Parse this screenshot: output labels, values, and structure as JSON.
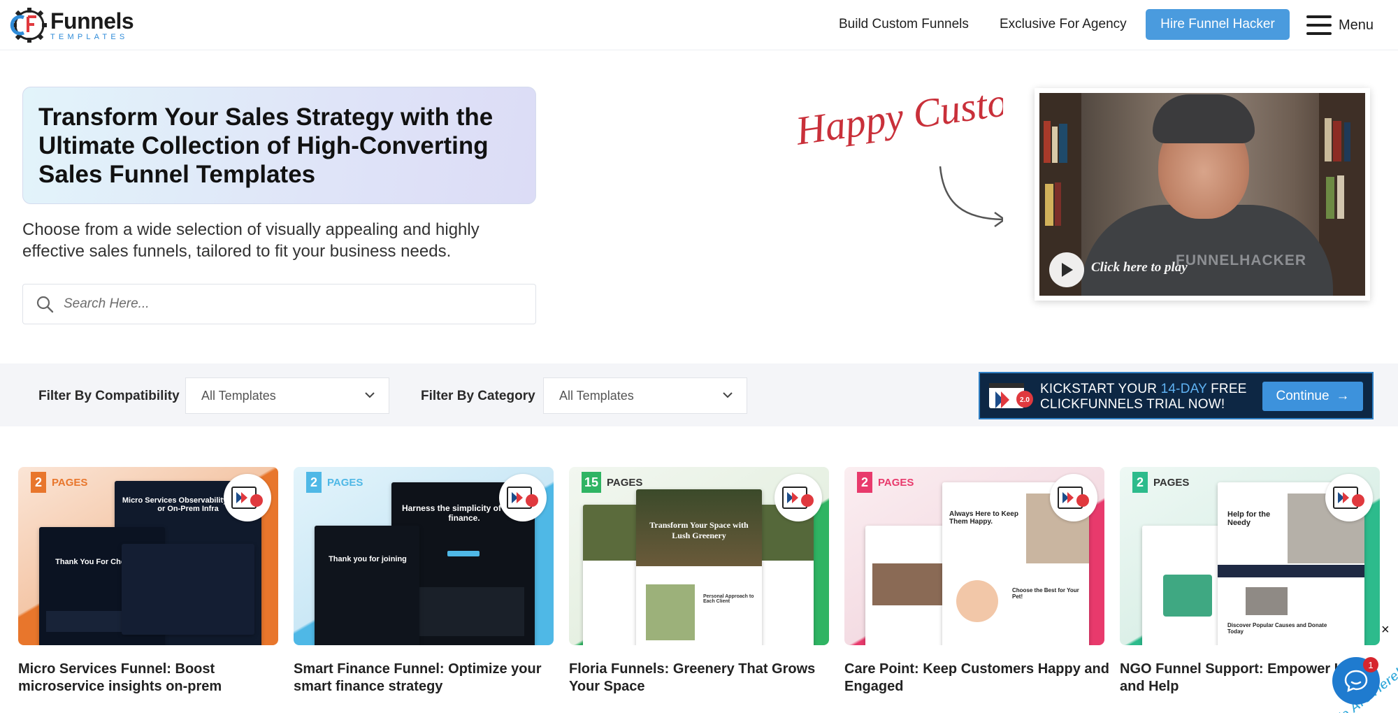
{
  "header": {
    "logo_name": "Funnels",
    "logo_sub": "TEMPLATES",
    "nav": [
      "Build Custom Funnels",
      "Exclusive For Agency"
    ],
    "cta": "Hire Funnel Hacker",
    "menu_label": "Menu"
  },
  "hero": {
    "title": "Transform Your Sales Strategy with the Ultimate Collection of High-Converting Sales Funnel Templates",
    "subtitle": "Choose from a wide selection of visually appealing and highly effective sales funnels, tailored to fit your business needs.",
    "search_placeholder": "Search Here...",
    "happy_label": "Happy Customer",
    "video_caption": "Click here to play",
    "video_shirt": "FUNNELHACKER"
  },
  "filters": {
    "compat_label": "Filter By Compatibility",
    "compat_value": "All Templates",
    "category_label": "Filter By Category",
    "category_value": "All Templates"
  },
  "promo": {
    "line1_a": "KICKSTART YOUR ",
    "line1_hl": "14-DAY",
    "line1_b": " FREE",
    "line2": "CLICKFUNNELS TRIAL NOW!",
    "button": "Continue",
    "badge": "2.0"
  },
  "cards": [
    {
      "pages": "2",
      "pages_label": "PAGES",
      "title": "Micro Services Funnel: Boost microservice insights on-prem",
      "mock_heading": "Micro Services Observability: Cloud or On-Prem Infra",
      "mock_heading2": "Thank You For Choosing"
    },
    {
      "pages": "2",
      "pages_label": "PAGES",
      "title": "Smart Finance Funnel: Optimize your smart finance strategy",
      "mock_heading": "Harness the simplicity of smart finance.",
      "mock_heading2": "Thank you for joining"
    },
    {
      "pages": "15",
      "pages_label": "PAGES",
      "title": "Floria Funnels: Greenery That Grows Your Space",
      "mock_heading": "Transform Your Space with Lush Greenery",
      "mock_heading2": "Personal Approach to Each Client"
    },
    {
      "pages": "2",
      "pages_label": "PAGES",
      "title": "Care Point: Keep Customers Happy and Engaged",
      "mock_heading": "Always Here to Keep Them Happy.",
      "mock_heading2": "Choose the Best for Your Pet!"
    },
    {
      "pages": "2",
      "pages_label": "PAGES",
      "title": "NGO Funnel Support: Empower Hope and Help",
      "mock_heading": "Help for the Needy",
      "mock_heading2": "Discover Popular Causes and Donate Today"
    }
  ],
  "chat": {
    "close": "×",
    "label": "We Are Here!",
    "badge": "1"
  },
  "colors": {
    "accent": "#4a9bde",
    "promo_bg": "#0d2744",
    "card1": "#e8762c",
    "card2": "#4fb8e6",
    "card3": "#2fb463",
    "card4": "#e83a6c",
    "card5": "#2dbb8c"
  }
}
